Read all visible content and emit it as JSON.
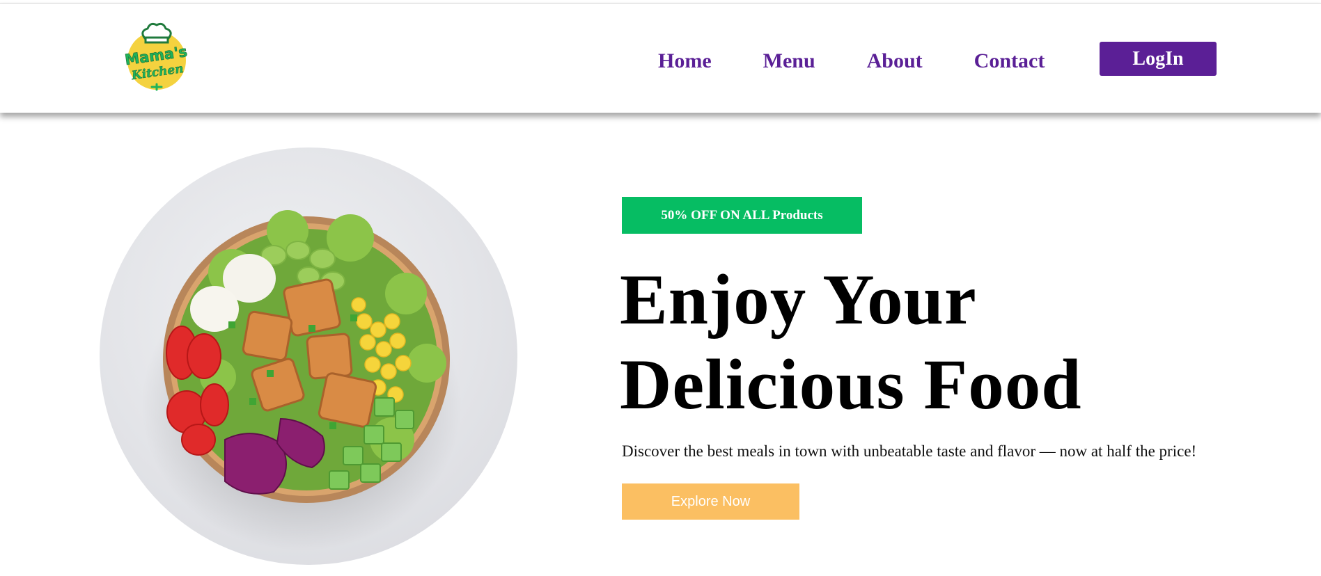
{
  "brand": {
    "logo_text_line1": "Mama's",
    "logo_text_line2": "Kitchen",
    "logo_colors": {
      "green": "#1fb35a",
      "yellow": "#f4d23f",
      "dark": "#1f7a3c"
    }
  },
  "nav": {
    "items": [
      {
        "label": "Home"
      },
      {
        "label": "Menu"
      },
      {
        "label": "About"
      },
      {
        "label": "Contact"
      }
    ],
    "login_label": "LogIn"
  },
  "hero": {
    "badge": "50% OFF ON ALL Products",
    "headline_line1": "Enjoy Your",
    "headline_line2": "Delicious Food",
    "subtitle": "Discover the best meals in town with unbeatable taste and flavor — now at half the price!",
    "cta_label": "Explore Now",
    "image_subject": "salad bowl"
  },
  "colors": {
    "nav_purple": "#5a1f96",
    "badge_green": "#06bd63",
    "cta_yellow": "#fbbf62",
    "text_black": "#000000"
  }
}
